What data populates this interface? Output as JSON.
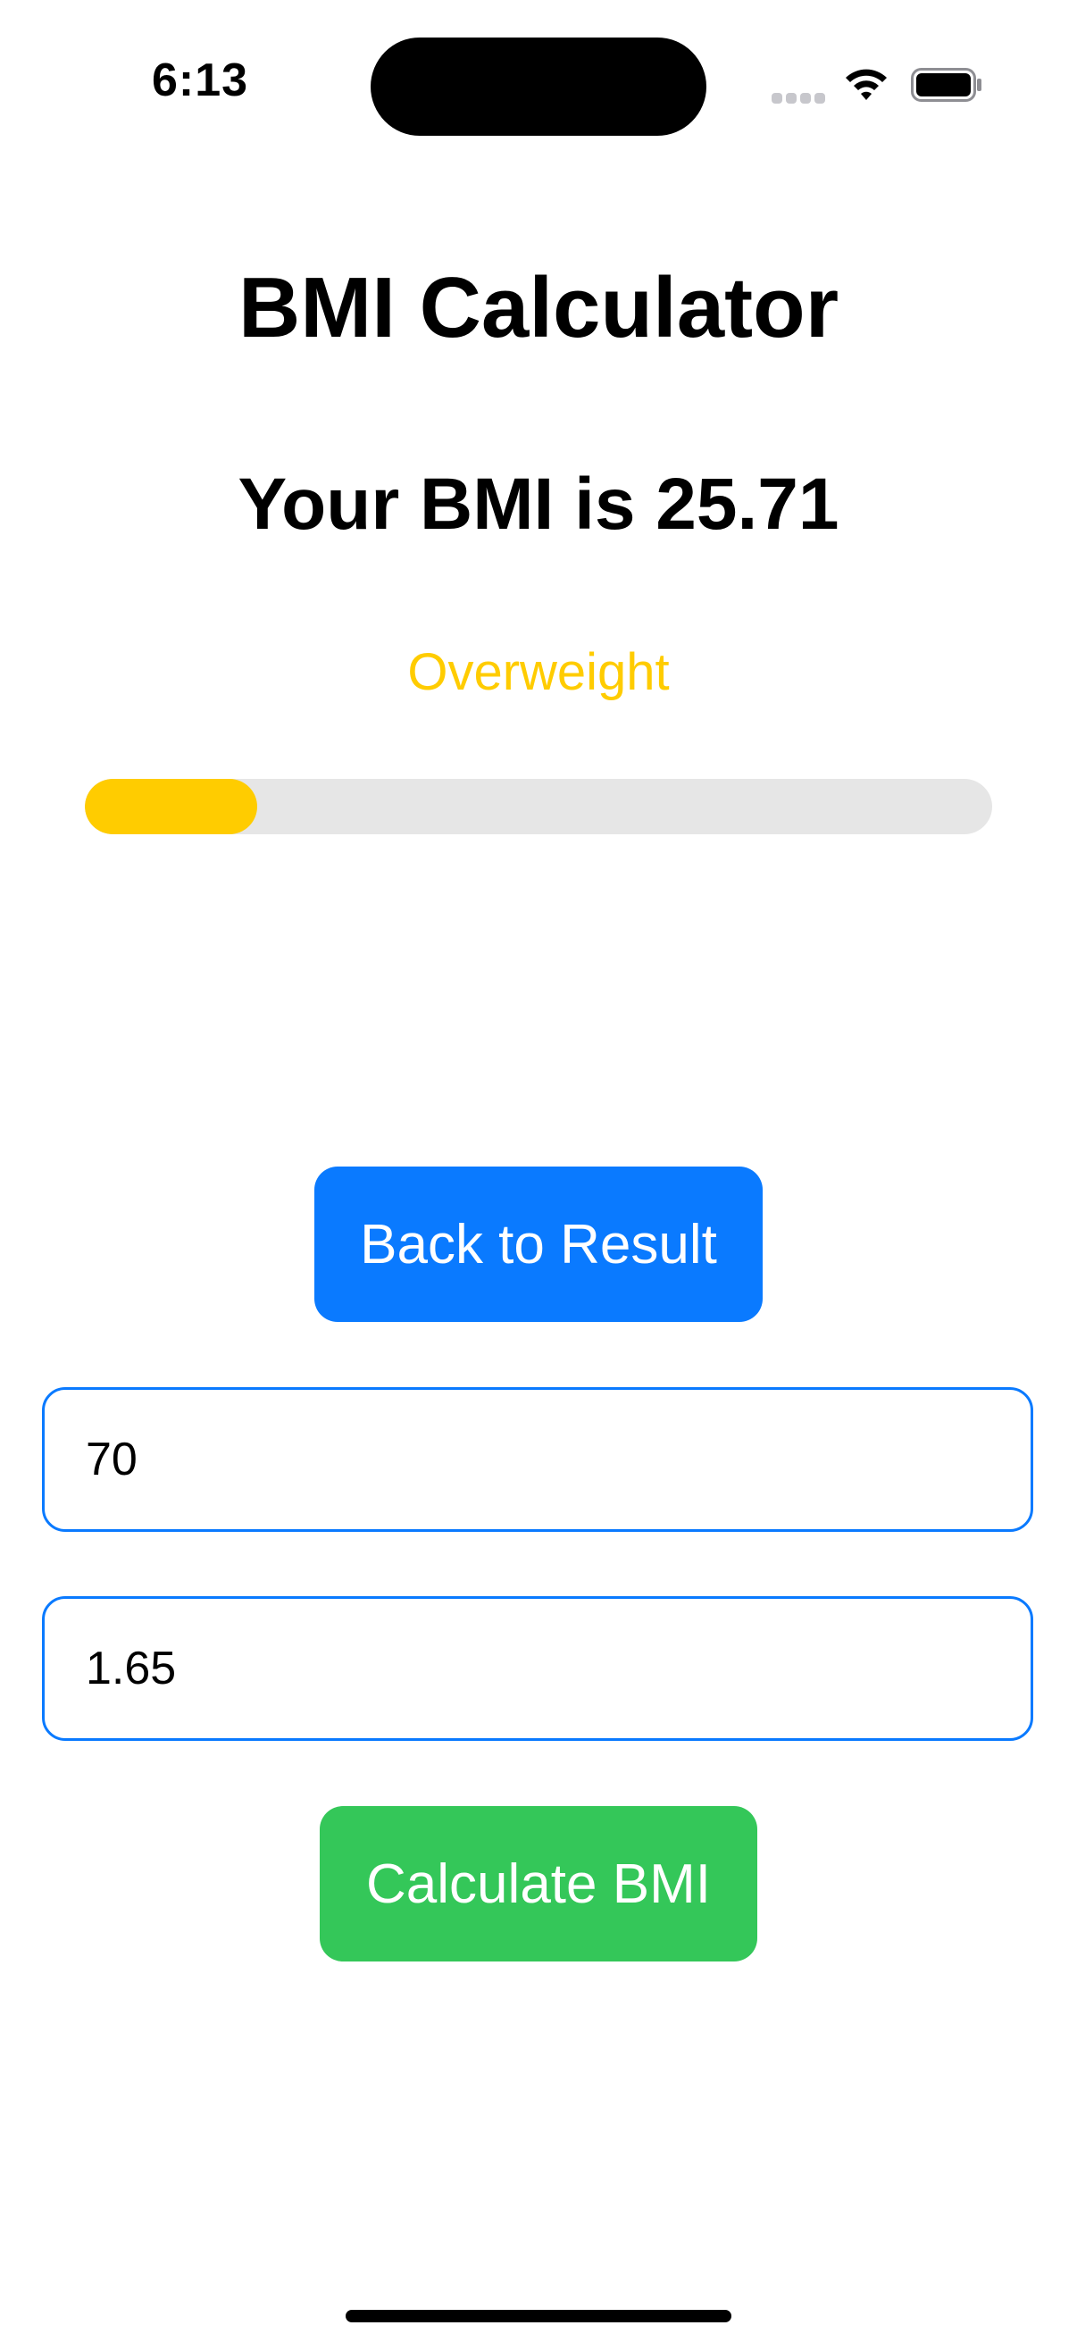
{
  "status_bar": {
    "time": "6:13",
    "signal_icon": "cellular-signal-icon",
    "wifi_icon": "wifi-icon",
    "battery_icon": "battery-icon"
  },
  "header": {
    "title": "BMI Calculator"
  },
  "result": {
    "text": "Your BMI is 25.71",
    "category": "Overweight",
    "category_color": "#ffcc00",
    "progress_fraction": 0.19
  },
  "actions": {
    "back_label": "Back to Result",
    "calculate_label": "Calculate BMI"
  },
  "inputs": {
    "weight_value": "70",
    "height_value": "1.65"
  },
  "colors": {
    "accent_blue": "#0a7aff",
    "accent_green": "#34c759",
    "accent_yellow": "#ffcc00",
    "track_gray": "#e6e6e6"
  }
}
